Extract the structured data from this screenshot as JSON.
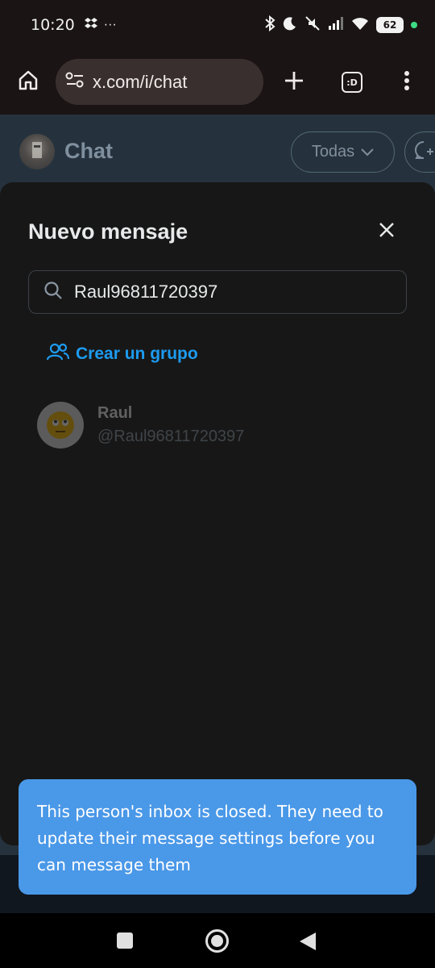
{
  "status_bar": {
    "time": "10:20",
    "extra": "···",
    "battery": "62",
    "icons": [
      "dropbox-icon",
      "bluetooth-icon",
      "moon-icon",
      "mute-icon",
      "signal-icon",
      "wifi-icon",
      "battery-icon"
    ]
  },
  "browser": {
    "url": "x.com/i/chat",
    "tabs_label": ":D"
  },
  "page": {
    "title": "Chat",
    "filter_label": "Todas"
  },
  "modal": {
    "title": "Nuevo mensaje",
    "search_value": "Raul96811720397",
    "create_group_label": "Crear un grupo",
    "result": {
      "name": "Raul",
      "handle": "@Raul96811720397"
    }
  },
  "toast": {
    "message": "This person's inbox is closed. They need to update their message settings before you can message them"
  },
  "colors": {
    "accent": "#1d9bf0",
    "toast_bg": "#4a98e8",
    "modal_bg": "#171717"
  }
}
